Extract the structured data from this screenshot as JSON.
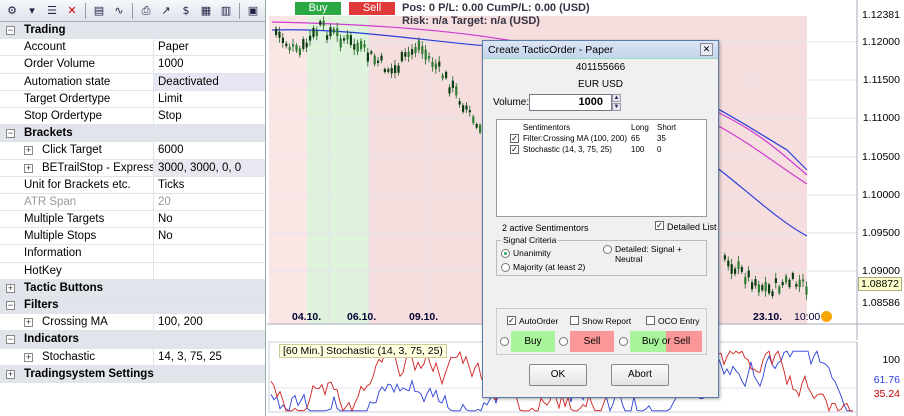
{
  "toolbar": {
    "icons": [
      "settings-icon",
      "dropdown-icon",
      "list-icon",
      "delete-icon",
      "strategy-icon",
      "chart-line-icon",
      "print-icon",
      "trend-icon",
      "currency-icon",
      "grid-icon",
      "table-icon",
      "window-icon"
    ]
  },
  "props": {
    "trading": {
      "label": "Trading",
      "account_key": "Account",
      "account_val": "Paper",
      "order_volume_key": "Order Volume",
      "order_volume_val": "1000",
      "automation_key": "Automation state",
      "automation_val": "Deactivated",
      "target_ordertype_key": "Target Ordertype",
      "target_ordertype_val": "Limit",
      "stop_ordertype_key": "Stop Ordertype",
      "stop_ordertype_val": "Stop"
    },
    "brackets": {
      "label": "Brackets",
      "click_target_key": "Click Target",
      "click_target_val": "6000",
      "betrail_key": "BETrailStop - Express",
      "betrail_val": "3000, 3000, 0, 0",
      "unit_key": "Unit for Brackets etc.",
      "unit_val": "Ticks",
      "atr_key": "ATR Span",
      "atr_val": "20",
      "multi_targets_key": "Multiple Targets",
      "multi_targets_val": "No",
      "multi_stops_key": "Multiple Stops",
      "multi_stops_val": "No",
      "information_key": "Information",
      "information_val": "",
      "hotkey_key": "HotKey",
      "hotkey_val": ""
    },
    "tactic_buttons": {
      "label": "Tactic Buttons"
    },
    "filters": {
      "label": "Filters",
      "crossing_key": "Crossing MA",
      "crossing_val": "100, 200"
    },
    "indicators": {
      "label": "Indicators",
      "stochastic_key": "Stochastic",
      "stochastic_val": "14, 3, 75, 25"
    },
    "tradingsystem": {
      "label": "Tradingsystem Settings"
    }
  },
  "chart": {
    "buy_label": "Buy",
    "sell_label": "Sell",
    "pos_line": "Pos: 0  P/L: 0.00  CumP/L: 0.00 (USD)",
    "risk_line": "Risk: n/a  Target: n/a (USD)",
    "price_ticks": [
      "1.12381",
      "1.12000",
      "1.11500",
      "1.11000",
      "1.10500",
      "1.10000",
      "1.09500",
      "1.09000",
      "1.08586"
    ],
    "current_price": "1.08872",
    "date_ticks": [
      "04.10.",
      "06.10.",
      "09.10.",
      "23.10.",
      "10:00"
    ],
    "colors": {
      "buy": "#2aa843",
      "sell": "#e03a3a",
      "green_zone": "#dff2dc",
      "red_zone": "#f7dede",
      "ma_fast": "#2a3fd8",
      "ma_slow": "#d03ad0"
    }
  },
  "stochastic": {
    "title": "[60 Min.] Stochastic  (14, 3, 75, 25)",
    "ticks": [
      "100",
      "61.76",
      "35.24"
    ]
  },
  "dialog": {
    "title": "Create TacticOrder - Paper",
    "close": "✕",
    "account_id": "401155666",
    "instrument": "EUR USD",
    "volume_label": "Volume:",
    "volume_value": "1000",
    "sentimentors_col": "Sentimentors",
    "long_col": "Long",
    "short_col": "Short",
    "rows": [
      {
        "name": "Filter:Crossing MA  (100, 200)",
        "long": "65",
        "short": "35",
        "checked": "✓"
      },
      {
        "name": "Stochastic  (14, 3, 75, 25)",
        "long": "100",
        "short": "0",
        "checked": "✓"
      }
    ],
    "active_count": "2 active Sentimentors",
    "detailed_list": "Detailed List",
    "detailed_checked": "✓",
    "signal_criteria": "Signal Criteria",
    "unanimity": "Unanimity",
    "majority": "Majority (at least 2)",
    "detailed_signal": "Detailed: Signal + Neutral",
    "auto_order": "AutoOrder",
    "auto_checked": "✓",
    "show_report": "Show Report",
    "oco_entry": "OCO Entry",
    "buy": "Buy",
    "sell": "Sell",
    "buy_or_sell": "Buy or Sell",
    "ok": "OK",
    "abort": "Abort"
  }
}
